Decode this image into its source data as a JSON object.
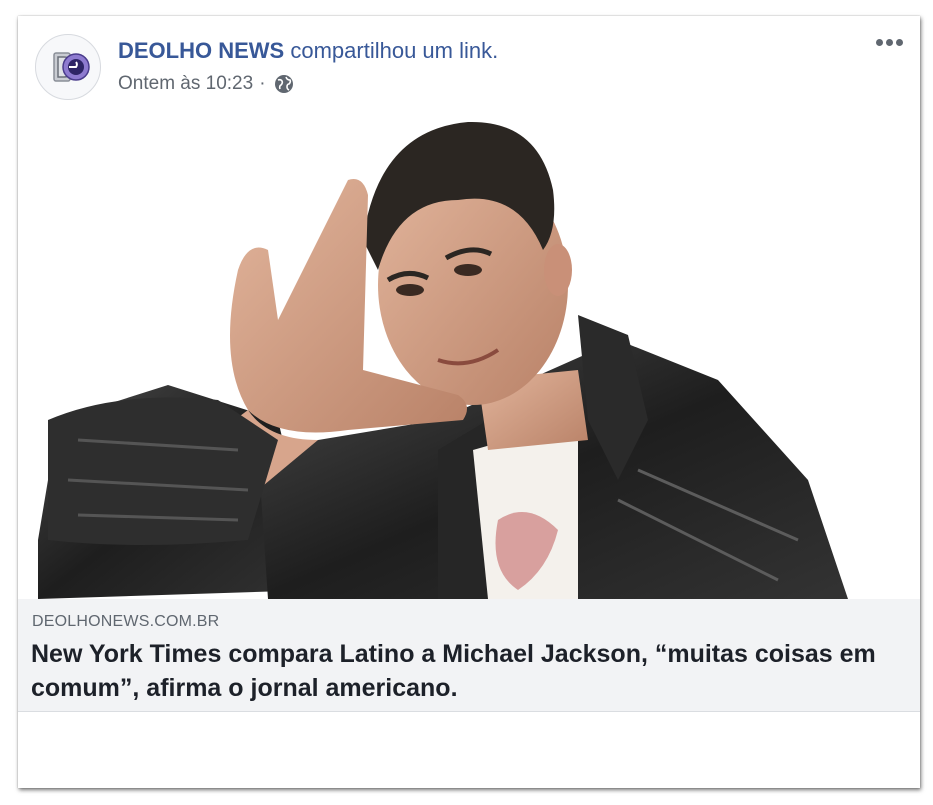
{
  "post": {
    "page_name": "DEOLHO NEWS",
    "shared_text": "compartilhou um",
    "shared_link": "link.",
    "timestamp": "Ontem às 10:23",
    "separator": "·",
    "privacy_icon": "globe-icon",
    "more_icon": "more-options-icon",
    "avatar_logo": "deolho-news-logo"
  },
  "link_preview": {
    "domain": "DEOLHONEWS.COM.BR",
    "headline": "New York Times compara Latino a Michael Jackson, “muitas coisas em comum”, afirma o jornal americano.",
    "image_alt": "man in leather jacket making L gesture"
  },
  "colors": {
    "link_blue": "#385898",
    "meta_gray": "#606770",
    "preview_bg": "#f2f3f5",
    "headline": "#1d2129"
  }
}
